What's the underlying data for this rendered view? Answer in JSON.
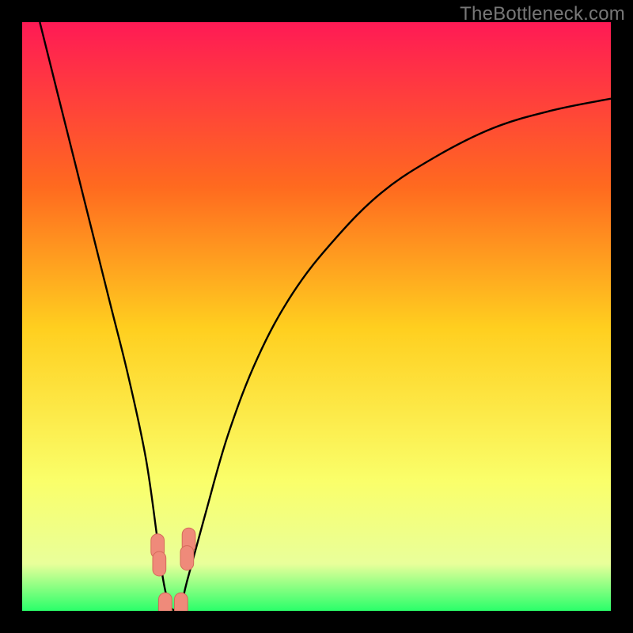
{
  "watermark": "TheBottleneck.com",
  "colors": {
    "frame": "#000000",
    "grad_top": "#ff1a55",
    "grad_upper_mid": "#ff6a1f",
    "grad_mid": "#ffcf1f",
    "grad_lower_mid": "#faff6a",
    "grad_band": "#e9ff9a",
    "grad_bottom": "#2aff6a",
    "curve": "#000000",
    "marker_fill": "#ef8a7a",
    "marker_stroke": "#d46a5a"
  },
  "chart_data": {
    "type": "line",
    "title": "",
    "xlabel": "",
    "ylabel": "",
    "xlim": [
      0,
      100
    ],
    "ylim": [
      0,
      100
    ],
    "series": [
      {
        "name": "bottleneck-curve",
        "x": [
          3,
          6,
          9,
          12,
          15,
          18,
          21,
          23,
          24,
          25,
          26,
          27,
          28,
          31,
          35,
          40,
          46,
          53,
          61,
          70,
          80,
          90,
          100
        ],
        "y": [
          100,
          88,
          76,
          64,
          52,
          40,
          26,
          12,
          5,
          1,
          0,
          1,
          5,
          16,
          30,
          43,
          54,
          63,
          71,
          77,
          82,
          85,
          87
        ]
      }
    ],
    "markers": [
      {
        "name": "left-top-cap",
        "x": 23.0,
        "y": 11.0,
        "r": 1.6
      },
      {
        "name": "left-bot-cap",
        "x": 23.3,
        "y": 8.0,
        "r": 1.6
      },
      {
        "name": "right-top-cap",
        "x": 28.3,
        "y": 12.0,
        "r": 1.6
      },
      {
        "name": "right-bot-cap",
        "x": 28.0,
        "y": 9.0,
        "r": 1.6
      },
      {
        "name": "valley-left",
        "x": 24.3,
        "y": 1.0,
        "r": 1.6
      },
      {
        "name": "valley-right",
        "x": 27.0,
        "y": 1.0,
        "r": 1.6
      }
    ]
  }
}
